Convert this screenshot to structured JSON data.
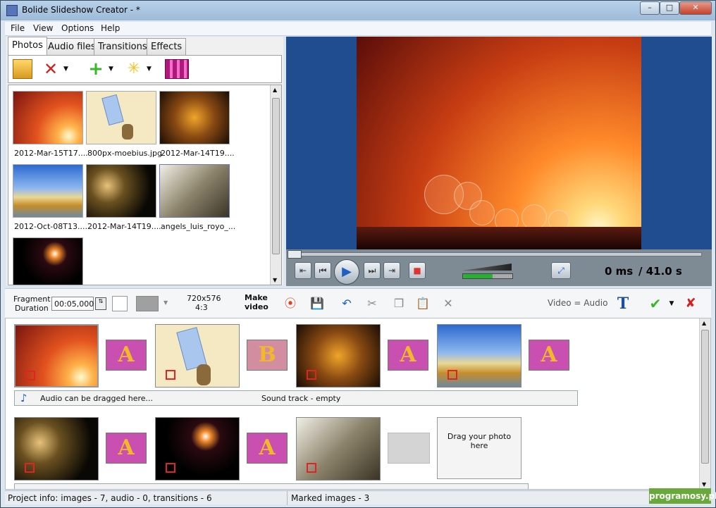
{
  "window": {
    "title": "Bolide Slideshow Creator - *",
    "controls": [
      "–",
      "□",
      "✕"
    ]
  },
  "menu": [
    "File",
    "View",
    "Options",
    "Help"
  ],
  "tabs": [
    "Photos",
    "Audio files",
    "Transitions",
    "Effects"
  ],
  "photos": [
    {
      "label": "2012-Mar-15T17....",
      "img": "sunset"
    },
    {
      "label": "800px-moebius.jpg",
      "img": "moebius"
    },
    {
      "label": "2012-Mar-14T19....",
      "img": "fire"
    },
    {
      "label": "2012-Oct-08T13....",
      "img": "sky"
    },
    {
      "label": "2012-Mar-14T19....",
      "img": "grass"
    },
    {
      "label": "angels_luis_royo_...",
      "img": "angel"
    },
    {
      "label": "",
      "img": "ring"
    }
  ],
  "player": {
    "time": "0 ms",
    "total": "/ 41.0 s"
  },
  "strip": {
    "fragment_label": "Fragment",
    "duration_label": "Duration",
    "duration_value": "00:05,000",
    "resolution": "720x576",
    "aspect": "4:3",
    "make_label": "Make",
    "video_label": "video",
    "video_audio": "Video = Audio"
  },
  "timeline": {
    "sound_left": "Audio can be dragged here...",
    "sound_right": "Sound track - empty",
    "drop_text": "Drag your photo here",
    "transitions_row1": [
      "A",
      "B",
      "A",
      "A"
    ],
    "transitions_row2": [
      "A",
      "A"
    ]
  },
  "status": {
    "project_info": "Project info: images - 7, audio - 0, transitions - 6",
    "marked": "Marked images - 3"
  },
  "watermark": "programosy.pl",
  "colors": {
    "accent": "#1e61c5",
    "transition": "#c94fb0",
    "mark": "#e02323"
  }
}
